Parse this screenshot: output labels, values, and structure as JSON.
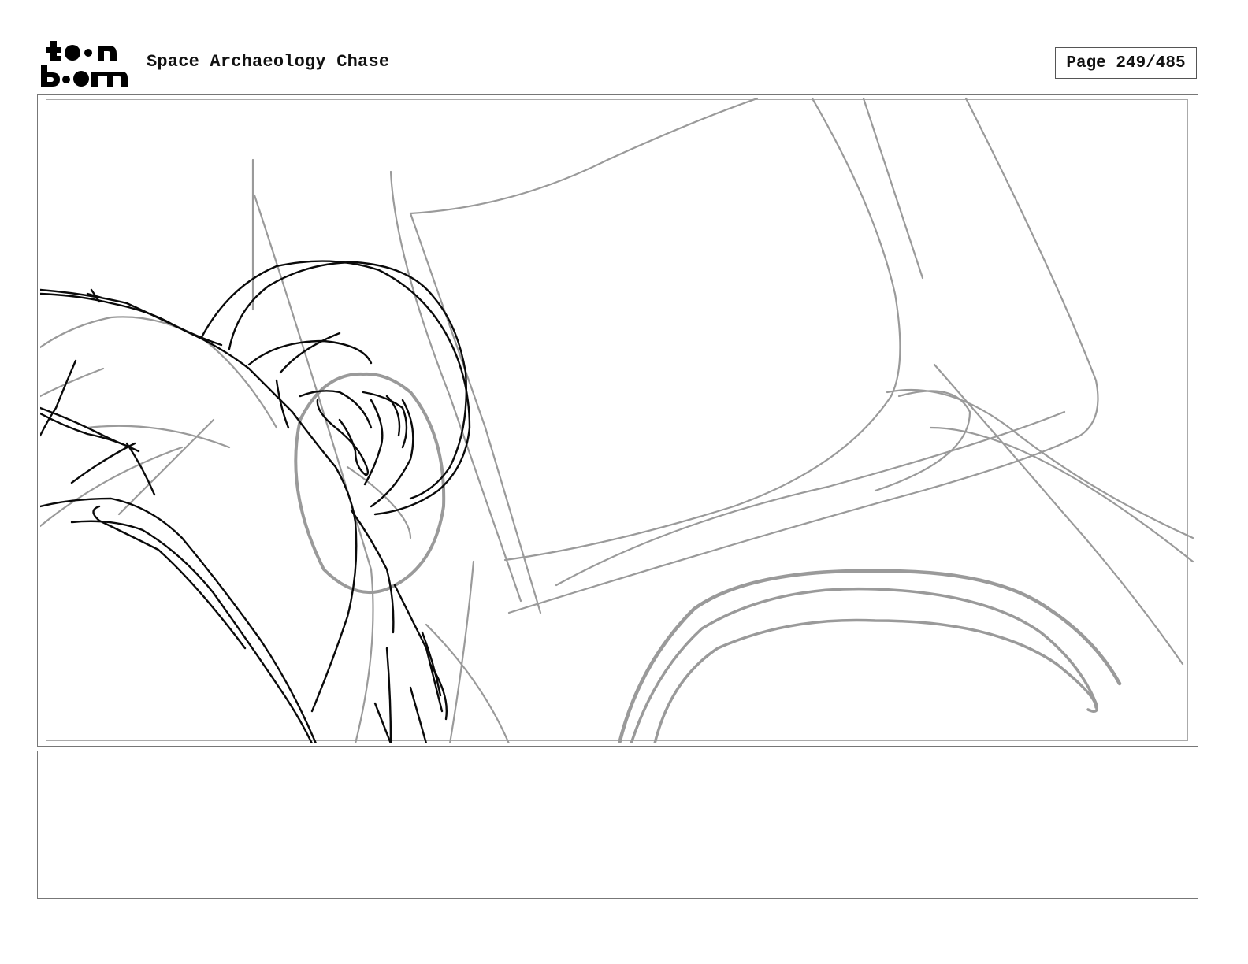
{
  "header": {
    "logo_text": "toon boom",
    "project_title": "Space Archaeology Chase",
    "page_label": "Page 249/485"
  },
  "panel": {
    "notes_text": ""
  },
  "colors": {
    "rough_line": "#9a9a9a",
    "ink_line": "#0a0a0a",
    "frame": "#777777"
  }
}
